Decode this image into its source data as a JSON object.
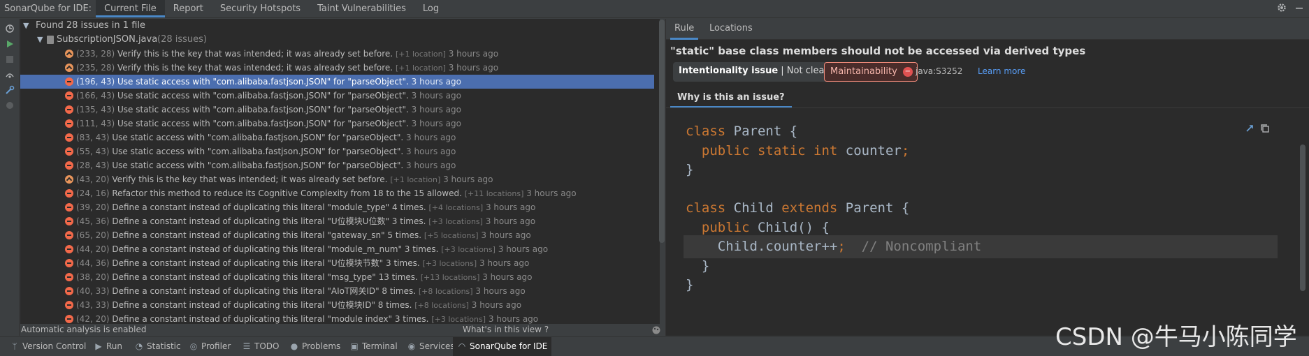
{
  "topbar": {
    "title": "SonarQube for IDE:",
    "tabs": [
      "Current File",
      "Report",
      "Security Hotspots",
      "Taint Vulnerabilities",
      "Log"
    ],
    "active_tab": "Current File",
    "right_icons": [
      "gear-icon",
      "minimize-icon"
    ]
  },
  "toolstrip": [
    "refresh-analysis-icon",
    "run-analysis-icon",
    "stop-icon",
    "network-icon",
    "settings-tools-icon",
    "info-icon"
  ],
  "tree": {
    "summary": "Found 28 issues in 1 file",
    "file_name": "SubscriptionJSON.java",
    "file_count": "(28 issues)",
    "issues": [
      {
        "sev": "major",
        "pos": "(233, 28)",
        "msg": "Verify this is the key that was intended; it was already set before.",
        "loc": "[+1 location]",
        "time": "3 hours ago"
      },
      {
        "sev": "major",
        "pos": "(235, 28)",
        "msg": "Verify this is the key that was intended; it was already set before.",
        "loc": "[+1 location]",
        "time": "3 hours ago"
      },
      {
        "sev": "critical",
        "pos": "(196, 43)",
        "msg": "Use static access with \"com.alibaba.fastjson.JSON\" for \"parseObject\".",
        "loc": "",
        "time": "3 hours ago",
        "selected": true
      },
      {
        "sev": "critical",
        "pos": "(166, 43)",
        "msg": "Use static access with \"com.alibaba.fastjson.JSON\" for \"parseObject\".",
        "loc": "",
        "time": "3 hours ago"
      },
      {
        "sev": "critical",
        "pos": "(135, 43)",
        "msg": "Use static access with \"com.alibaba.fastjson.JSON\" for \"parseObject\".",
        "loc": "",
        "time": "3 hours ago"
      },
      {
        "sev": "critical",
        "pos": "(111, 43)",
        "msg": "Use static access with \"com.alibaba.fastjson.JSON\" for \"parseObject\".",
        "loc": "",
        "time": "3 hours ago"
      },
      {
        "sev": "critical",
        "pos": "(83, 43)",
        "msg": "Use static access with \"com.alibaba.fastjson.JSON\" for \"parseObject\".",
        "loc": "",
        "time": "3 hours ago"
      },
      {
        "sev": "critical",
        "pos": "(55, 43)",
        "msg": "Use static access with \"com.alibaba.fastjson.JSON\" for \"parseObject\".",
        "loc": "",
        "time": "3 hours ago"
      },
      {
        "sev": "critical",
        "pos": "(28, 43)",
        "msg": "Use static access with \"com.alibaba.fastjson.JSON\" for \"parseObject\".",
        "loc": "",
        "time": "3 hours ago"
      },
      {
        "sev": "major",
        "pos": "(43, 20)",
        "msg": "Verify this is the key that was intended; it was already set before.",
        "loc": "[+1 location]",
        "time": "3 hours ago"
      },
      {
        "sev": "critical",
        "pos": "(24, 16)",
        "msg": "Refactor this method to reduce its Cognitive Complexity from 18 to the 15 allowed.",
        "loc": "[+11 locations]",
        "time": "3 hours ago"
      },
      {
        "sev": "critical",
        "pos": "(39, 20)",
        "msg": "Define a constant instead of duplicating this literal \"module_type\" 4 times.",
        "loc": "[+4 locations]",
        "time": "3 hours ago"
      },
      {
        "sev": "critical",
        "pos": "(45, 36)",
        "msg": "Define a constant instead of duplicating this literal \"U位模块U位数\" 3 times.",
        "loc": "[+3 locations]",
        "time": "3 hours ago"
      },
      {
        "sev": "critical",
        "pos": "(65, 20)",
        "msg": "Define a constant instead of duplicating this literal \"gateway_sn\" 5 times.",
        "loc": "[+5 locations]",
        "time": "3 hours ago"
      },
      {
        "sev": "critical",
        "pos": "(44, 20)",
        "msg": "Define a constant instead of duplicating this literal \"module_m_num\" 3 times.",
        "loc": "[+3 locations]",
        "time": "3 hours ago"
      },
      {
        "sev": "critical",
        "pos": "(44, 36)",
        "msg": "Define a constant instead of duplicating this literal \"U位模块节数\" 3 times.",
        "loc": "[+3 locations]",
        "time": "3 hours ago"
      },
      {
        "sev": "critical",
        "pos": "(38, 20)",
        "msg": "Define a constant instead of duplicating this literal \"msg_type\" 13 times.",
        "loc": "[+13 locations]",
        "time": "3 hours ago"
      },
      {
        "sev": "critical",
        "pos": "(40, 33)",
        "msg": "Define a constant instead of duplicating this literal \"AIoT网关ID\" 8 times.",
        "loc": "[+8 locations]",
        "time": "3 hours ago"
      },
      {
        "sev": "critical",
        "pos": "(43, 33)",
        "msg": "Define a constant instead of duplicating this literal \"U位模块ID\" 8 times.",
        "loc": "[+8 locations]",
        "time": "3 hours ago"
      },
      {
        "sev": "critical",
        "pos": "(42, 20)",
        "msg": "Define a constant instead of duplicating this literal \"module index\" 3 times.",
        "loc": "[+3 locations]",
        "time": "3 hours ago"
      }
    ]
  },
  "status": {
    "text": "Automatic analysis is enabled",
    "whats_new": "What's in this view ?"
  },
  "rule": {
    "tabs": [
      "Rule",
      "Locations"
    ],
    "active_tab": "Rule",
    "title": "\"static\" base class members should not be accessed via derived types",
    "chip1_bold": "Intentionality issue",
    "chip1_rest": " | Not clear",
    "chip2": "Maintainability",
    "key": "java:S3252",
    "learn_more": "Learn more",
    "why_tab": "Why is this an issue?"
  },
  "code": [
    [
      {
        "t": "class",
        "c": "kw"
      },
      {
        "t": " Parent {",
        "c": ""
      }
    ],
    [
      {
        "t": "  ",
        "c": ""
      },
      {
        "t": "public static int",
        "c": "kw"
      },
      {
        "t": " counter",
        "c": ""
      },
      {
        "t": ";",
        "c": "kw"
      }
    ],
    [
      {
        "t": "}",
        "c": ""
      }
    ],
    [
      {
        "t": "",
        "c": ""
      }
    ],
    [
      {
        "t": "class",
        "c": "kw"
      },
      {
        "t": " Child ",
        "c": ""
      },
      {
        "t": "extends",
        "c": "kw"
      },
      {
        "t": " Parent {",
        "c": ""
      }
    ],
    [
      {
        "t": "  ",
        "c": ""
      },
      {
        "t": "public",
        "c": "kw"
      },
      {
        "t": " Child() {",
        "c": ""
      }
    ],
    [
      {
        "t": "    Child.counter++",
        "c": ""
      },
      {
        "t": ";",
        "c": "kw"
      },
      {
        "t": "  // Noncompliant",
        "c": "cm"
      }
    ],
    [
      {
        "t": "  }",
        "c": ""
      }
    ],
    [
      {
        "t": "}",
        "c": ""
      }
    ]
  ],
  "code_highlight_line": 6,
  "bottombar": [
    {
      "icon": "version-control-icon",
      "label": "Version Control"
    },
    {
      "icon": "run-icon",
      "label": "Run"
    },
    {
      "icon": "statistic-icon",
      "label": "Statistic"
    },
    {
      "icon": "profiler-icon",
      "label": "Profiler"
    },
    {
      "icon": "todo-icon",
      "label": "TODO"
    },
    {
      "icon": "problems-icon",
      "label": "Problems"
    },
    {
      "icon": "terminal-icon",
      "label": "Terminal"
    },
    {
      "icon": "services-icon",
      "label": "Services"
    },
    {
      "icon": "sonarqube-icon",
      "label": "SonarQube for IDE",
      "active": true
    }
  ],
  "watermark": "CSDN @牛马小陈同学",
  "colors": {
    "accent": "#4a88c7",
    "selection": "#4b6eaf",
    "critical": "#f3694a",
    "major": "#e8955b",
    "keyword": "#cc7832",
    "link": "#589df6"
  }
}
